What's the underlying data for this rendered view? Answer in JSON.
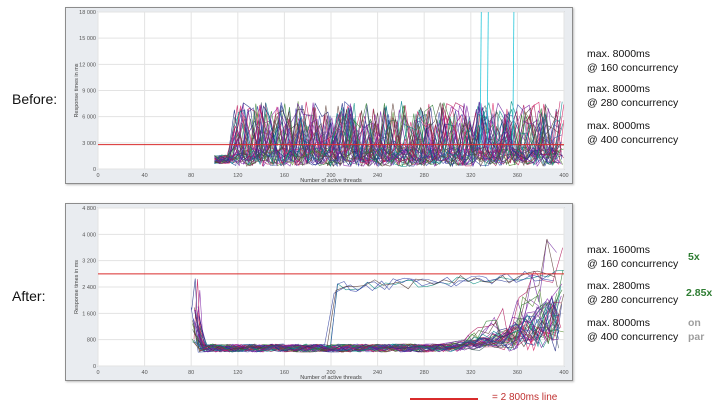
{
  "labels": {
    "before": "Before:",
    "after": "After:"
  },
  "colors": {
    "threshold": "#d92b2b",
    "improvement": "#2e7d32",
    "neutral": "#9e9e9e"
  },
  "before": {
    "stats": [
      {
        "line1": "max. 8000ms",
        "line2": "@ 160 concurrency"
      },
      {
        "line1": "max. 8000ms",
        "line2": "@ 280 concurrency"
      },
      {
        "line1": "max. 8000ms",
        "line2": "@ 400 concurrency"
      }
    ]
  },
  "after": {
    "stats": [
      {
        "line1": "max. 1600ms",
        "line2": "@ 160 concurrency",
        "ratio": "5x"
      },
      {
        "line1": "max. 2800ms",
        "line2": "@ 280 concurrency",
        "ratio": "2.85x"
      },
      {
        "line1": "max. 8000ms",
        "line2": "@ 400 concurrency",
        "ratio_top": "on",
        "ratio_bottom": "par"
      }
    ]
  },
  "legend": {
    "text": "= 2 800ms line"
  },
  "chart_data": [
    {
      "type": "line",
      "panel": "before",
      "xlabel": "Number of active threads",
      "ylabel": "Response times in ms",
      "xlim": [
        0,
        400
      ],
      "ylim": [
        0,
        18000
      ],
      "xticks": [
        0,
        40,
        80,
        120,
        160,
        200,
        240,
        280,
        320,
        360,
        400
      ],
      "yticks": [
        0,
        3000,
        6000,
        9000,
        12000,
        15000,
        18000
      ],
      "ytick_labels": [
        "0",
        "3 000",
        "6 000",
        "9 000",
        "12 000",
        "15 000",
        "18 000"
      ],
      "threshold_ms": 2800,
      "series_count": 40,
      "x_start": 100,
      "x_end": 400,
      "base_ms": 2000,
      "noise_ms": 5800,
      "cap_ms": 8000,
      "spikes": [
        {
          "x": 328,
          "y_max": 18000
        },
        {
          "x": 334,
          "y_max": 18000
        },
        {
          "x": 356,
          "y_max": 18000
        }
      ]
    },
    {
      "type": "line",
      "panel": "after",
      "xlabel": "Number of active threads",
      "ylabel": "Response times in ms",
      "xlim": [
        0,
        400
      ],
      "ylim": [
        0,
        4800
      ],
      "xticks": [
        0,
        40,
        80,
        120,
        160,
        200,
        240,
        280,
        320,
        360,
        400
      ],
      "yticks": [
        0,
        800,
        1600,
        2400,
        3200,
        4000,
        4800
      ],
      "ytick_labels": [
        "0",
        "800",
        "1 600",
        "2 400",
        "3 200",
        "4 000",
        "4 800"
      ],
      "threshold_ms": 2800,
      "series_count": 40,
      "x_start": 80,
      "x_end": 400,
      "initial_spike_ms": 2700,
      "base_ms": 420,
      "growth_from_x": 280,
      "final_max_ms": 4800
    }
  ]
}
